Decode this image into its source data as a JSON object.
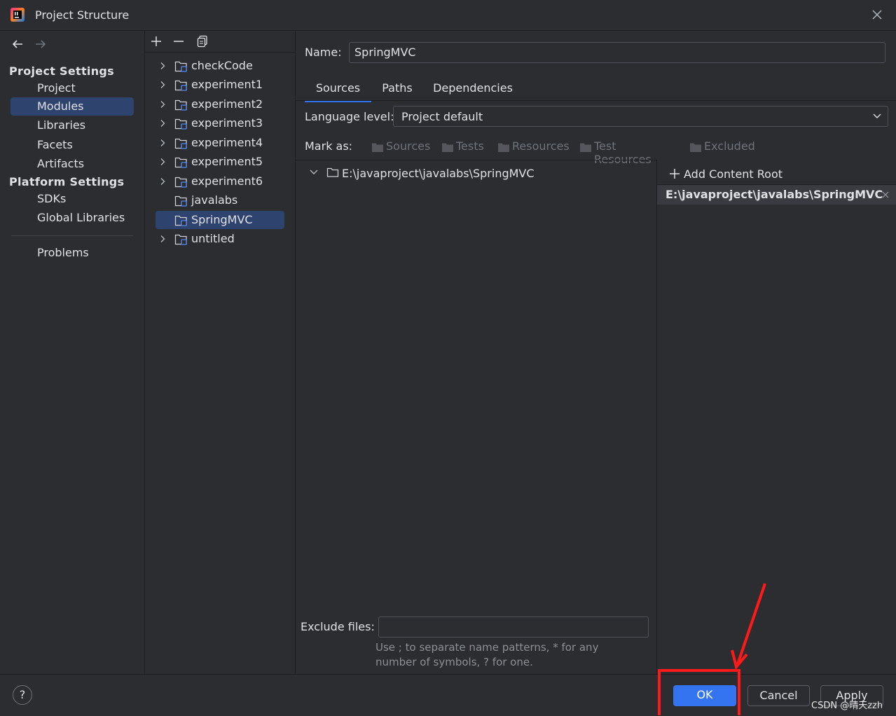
{
  "window": {
    "title": "Project Structure"
  },
  "left_nav": {
    "project_settings_heading": "Project Settings",
    "project_items": [
      "Project",
      "Modules",
      "Libraries",
      "Facets",
      "Artifacts"
    ],
    "platform_settings_heading": "Platform Settings",
    "platform_items": [
      "SDKs",
      "Global Libraries"
    ],
    "problems": "Problems",
    "selected": "Modules"
  },
  "modules": [
    {
      "name": "checkCode",
      "expandable": true
    },
    {
      "name": "experiment1",
      "expandable": true
    },
    {
      "name": "experiment2",
      "expandable": true
    },
    {
      "name": "experiment3",
      "expandable": true
    },
    {
      "name": "experiment4",
      "expandable": true
    },
    {
      "name": "experiment5",
      "expandable": true
    },
    {
      "name": "experiment6",
      "expandable": true
    },
    {
      "name": "javalabs",
      "expandable": false
    },
    {
      "name": "SpringMVC",
      "expandable": false,
      "selected": true
    },
    {
      "name": "untitled",
      "expandable": true
    }
  ],
  "details": {
    "name_label": "Name:",
    "name_value": "SpringMVC",
    "tabs": [
      "Sources",
      "Paths",
      "Dependencies"
    ],
    "active_tab": "Sources",
    "language_level_label": "Language level:",
    "language_level_value": "Project default",
    "mark_as_label": "Mark as:",
    "mark_as_options": [
      "Sources",
      "Tests",
      "Resources",
      "Test Resources",
      "Excluded"
    ],
    "tree_root": "E:\\javaproject\\javalabs\\SpringMVC",
    "add_content_root": "Add Content Root",
    "content_root": "E:\\javaproject\\javalabs\\SpringMVC",
    "exclude_files_label": "Exclude files:",
    "exclude_files_value": "",
    "exclude_hint_line1": "Use ; to separate name patterns, * for any",
    "exclude_hint_line2": "number of symbols, ? for one."
  },
  "footer": {
    "help": "?",
    "ok": "OK",
    "cancel": "Cancel",
    "apply": "Apply",
    "watermark": "CSDN @晴天zzh"
  },
  "colors": {
    "background": "#2b2d30",
    "selection": "#2e436e",
    "accent": "#3574f0",
    "annotation": "#ff1a1a"
  }
}
